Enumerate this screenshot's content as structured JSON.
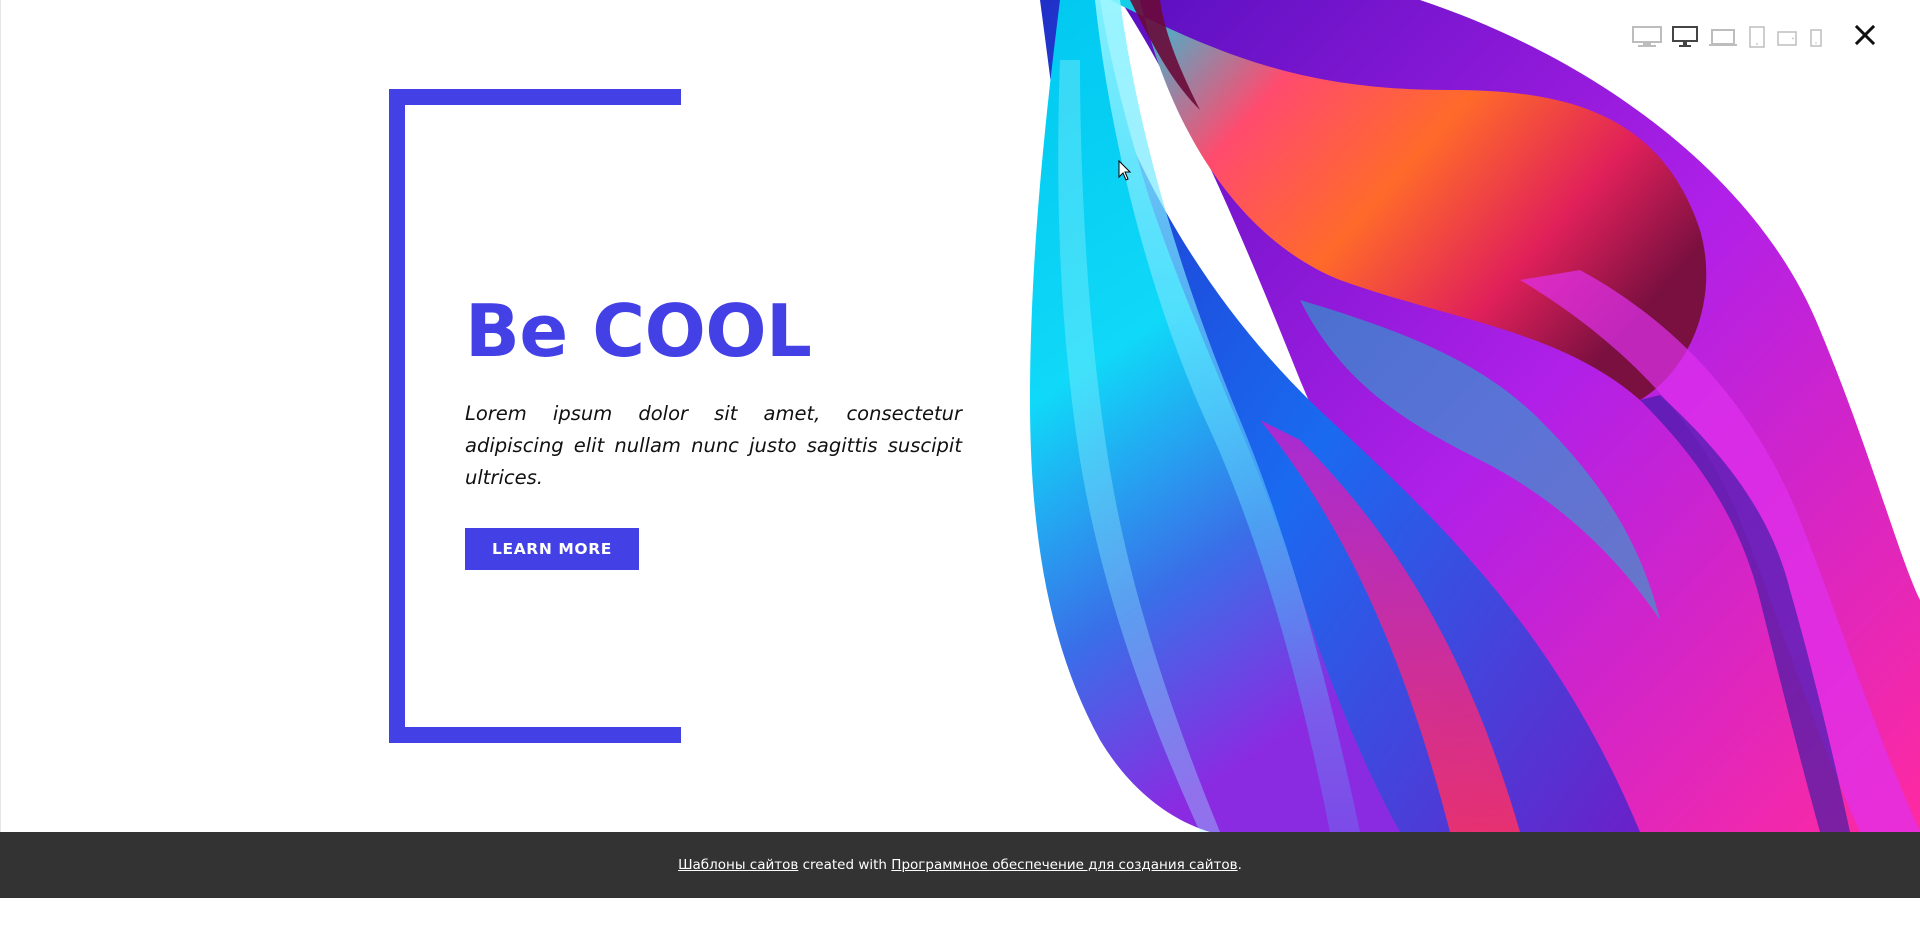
{
  "hero": {
    "title": "Be COOL",
    "lead": "Lorem ipsum dolor sit amet, consectetur adipiscing elit nullam nunc justo sagittis suscipit ultrices.",
    "button_label": "LEARN MORE"
  },
  "toolbar": {
    "devices": [
      "desktop-wide-icon",
      "desktop-icon",
      "laptop-icon",
      "tablet-portrait-icon",
      "tablet-landscape-icon",
      "phone-icon"
    ],
    "active_device": "desktop-icon",
    "close_icon": "close-icon"
  },
  "footer": {
    "link1": "Шаблоны сайтов",
    "middle": " created with ",
    "link2": "Программное обеспечение для создания сайтов",
    "end": "."
  },
  "colors": {
    "accent": "#4340e6",
    "footer_bg": "#333333"
  }
}
